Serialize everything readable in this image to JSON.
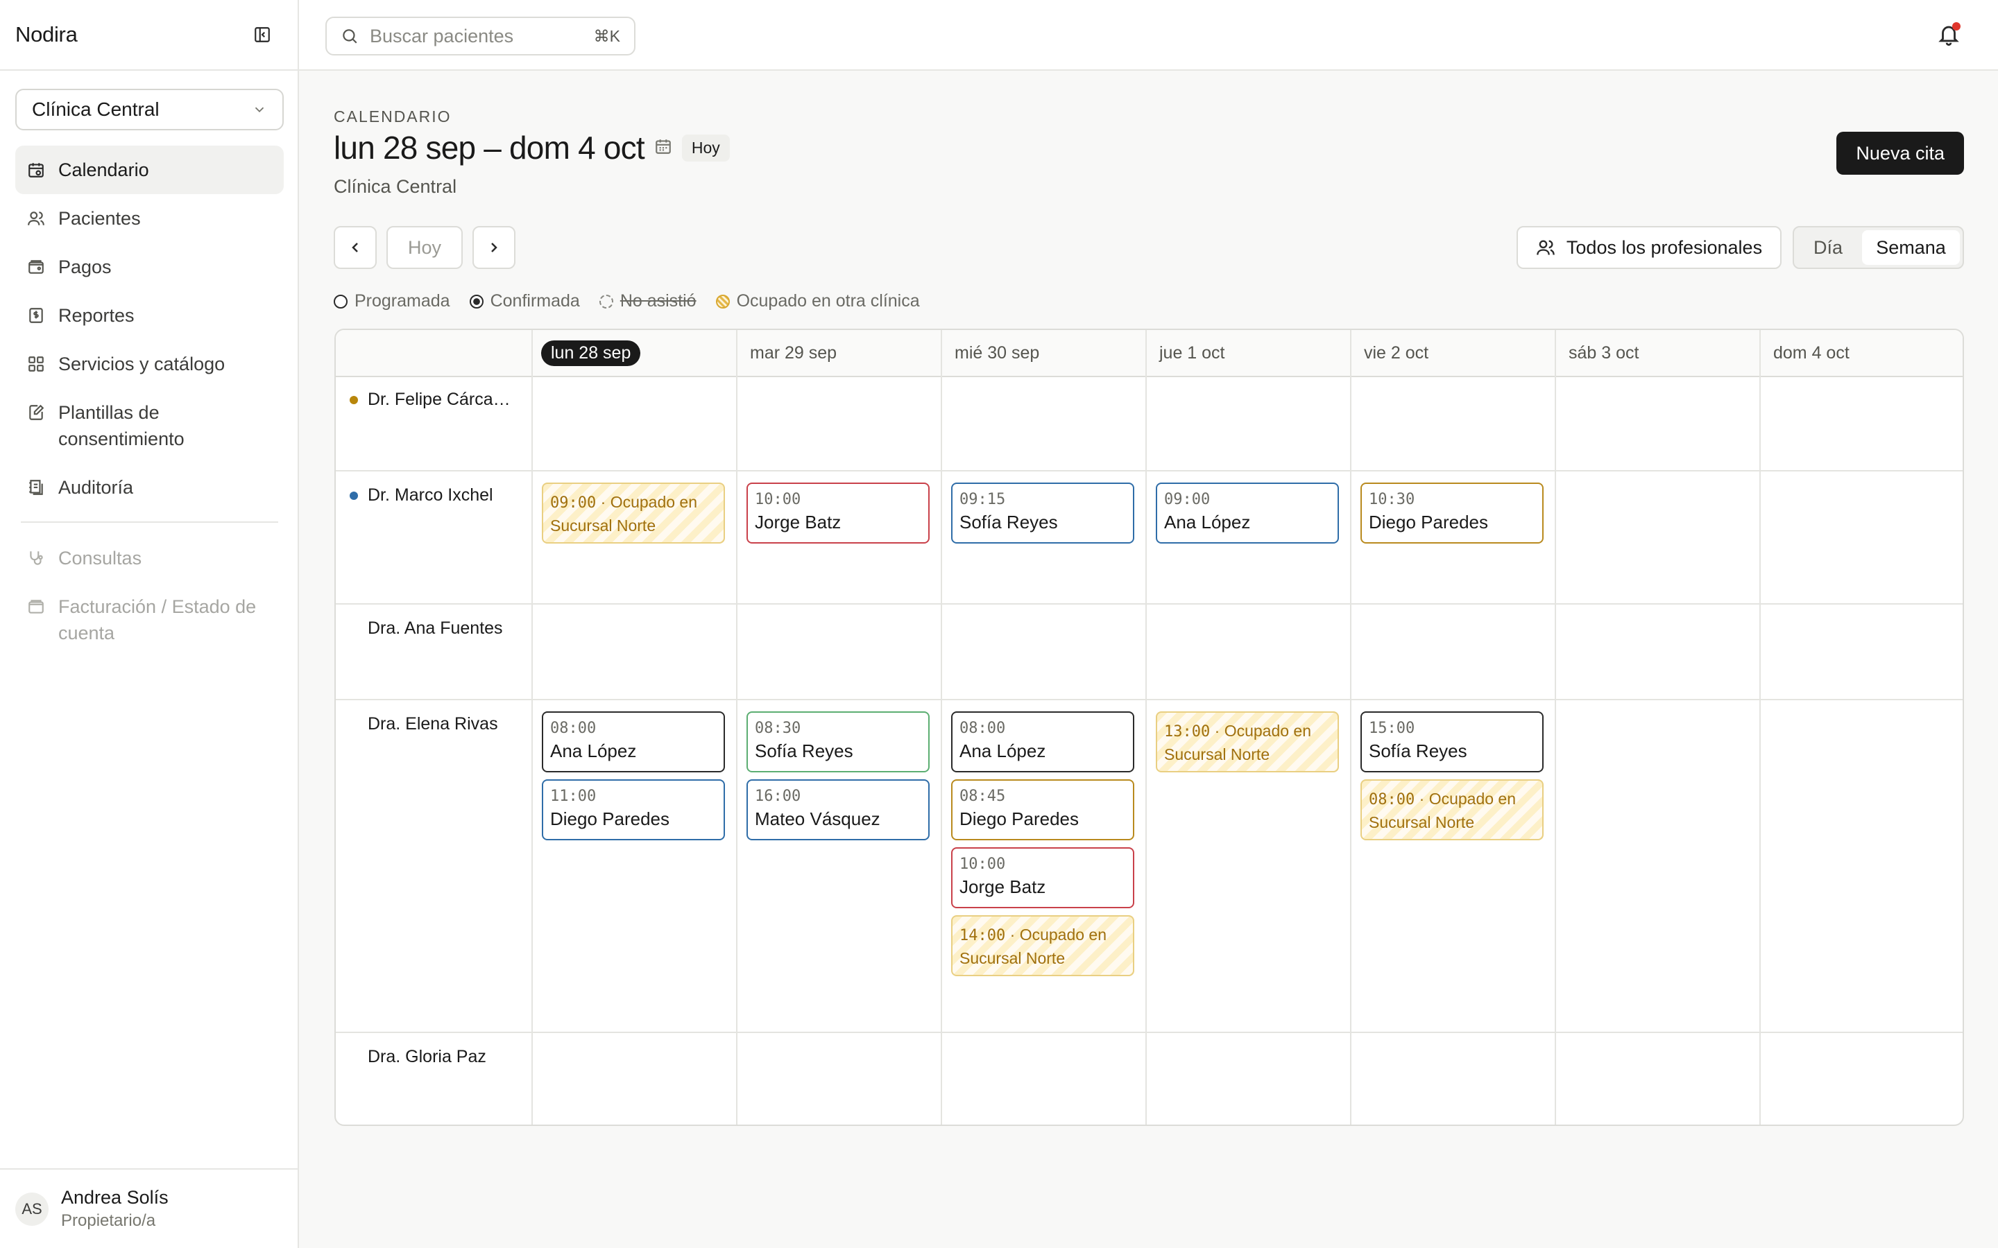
{
  "app": {
    "brand": "Nodira",
    "clinic_selected": "Clínica Central"
  },
  "sidebar": {
    "items": [
      {
        "label": "Calendario",
        "icon": "calendar-icon",
        "active": true
      },
      {
        "label": "Pacientes",
        "icon": "users-icon"
      },
      {
        "label": "Pagos",
        "icon": "wallet-icon"
      },
      {
        "label": "Reportes",
        "icon": "receipt-icon"
      },
      {
        "label": "Servicios y catálogo",
        "icon": "grid-icon"
      },
      {
        "label": "Plantillas de consentimiento",
        "icon": "document-edit-icon"
      },
      {
        "label": "Auditoría",
        "icon": "audit-icon"
      }
    ],
    "disabled_items": [
      {
        "label": "Consultas",
        "icon": "stethoscope-icon"
      },
      {
        "label": "Facturación / Estado de cuenta",
        "icon": "billing-icon"
      }
    ],
    "user": {
      "initials": "AS",
      "name": "Andrea Solís",
      "role": "Propietario/a"
    }
  },
  "topbar": {
    "search_placeholder": "Buscar pacientes",
    "search_shortcut": "⌘K"
  },
  "header": {
    "eyebrow": "CALENDARIO",
    "title": "lun 28 sep – dom 4 oct",
    "today_chip": "Hoy",
    "subtitle": "Clínica Central",
    "new_button": "Nueva cita"
  },
  "controls": {
    "today_button": "Hoy",
    "professionals_filter": "Todos los profesionales",
    "view_day": "Día",
    "view_week": "Semana"
  },
  "legend": {
    "scheduled": "Programada",
    "confirmed": "Confirmada",
    "no_show": "No asistió",
    "busy_other": "Ocupado en otra clínica"
  },
  "calendar": {
    "days": [
      "lun 28 sep",
      "mar 29 sep",
      "mié 30 sep",
      "jue 1 oct",
      "vie 2 oct",
      "sáb 3 oct",
      "dom 4 oct"
    ],
    "today_index": 0,
    "professionals": [
      {
        "name": "Dr. Felipe Cárca…",
        "dot": "#b8860b"
      },
      {
        "name": "Dr. Marco Ixchel",
        "dot": "#2f6da8"
      },
      {
        "name": "Dra. Ana Fuentes",
        "dot": ""
      },
      {
        "name": "Dra. Elena Rivas",
        "dot": ""
      },
      {
        "name": "Dra. Gloria Paz",
        "dot": ""
      }
    ],
    "appointments": [
      {
        "prof": 1,
        "day": 0,
        "slot": 0,
        "time": "09:00",
        "busy": true,
        "text": "Ocupado en Sucursal Norte"
      },
      {
        "prof": 1,
        "day": 1,
        "slot": 0,
        "time": "10:00",
        "name": "Jorge Batz",
        "color": "red"
      },
      {
        "prof": 1,
        "day": 2,
        "slot": 0,
        "time": "09:15",
        "name": "Sofía Reyes",
        "color": "blue"
      },
      {
        "prof": 1,
        "day": 3,
        "slot": 0,
        "time": "09:00",
        "name": "Ana López",
        "color": "blue"
      },
      {
        "prof": 1,
        "day": 4,
        "slot": 0,
        "time": "10:30",
        "name": "Diego Paredes",
        "color": "gold"
      },
      {
        "prof": 3,
        "day": 0,
        "slot": 0,
        "time": "08:00",
        "name": "Ana López",
        "color": "dark"
      },
      {
        "prof": 3,
        "day": 0,
        "slot": 1,
        "time": "11:00",
        "name": "Diego Paredes",
        "color": "blue"
      },
      {
        "prof": 3,
        "day": 1,
        "slot": 0,
        "time": "08:30",
        "name": "Sofía Reyes",
        "color": "green"
      },
      {
        "prof": 3,
        "day": 1,
        "slot": 1,
        "time": "16:00",
        "name": "Mateo Vásquez",
        "color": "blue"
      },
      {
        "prof": 3,
        "day": 2,
        "slot": 0,
        "time": "08:00",
        "name": "Ana López",
        "color": "dark"
      },
      {
        "prof": 3,
        "day": 2,
        "slot": 1,
        "time": "08:45",
        "name": "Diego Paredes",
        "color": "gold"
      },
      {
        "prof": 3,
        "day": 2,
        "slot": 2,
        "time": "10:00",
        "name": "Jorge Batz",
        "color": "red"
      },
      {
        "prof": 3,
        "day": 2,
        "slot": 3,
        "time": "14:00",
        "busy": true,
        "text": "Ocupado en Sucursal Norte"
      },
      {
        "prof": 3,
        "day": 3,
        "slot": 0,
        "time": "13:00",
        "busy": true,
        "text": "Ocupado en Sucursal Norte"
      },
      {
        "prof": 3,
        "day": 4,
        "slot": 0,
        "time": "15:00",
        "name": "Sofía Reyes",
        "color": "dark"
      },
      {
        "prof": 3,
        "day": 4,
        "slot": 1,
        "time": "08:00",
        "busy": true,
        "text": "Ocupado en Sucursal Norte"
      }
    ]
  },
  "colors": {
    "accent": "#1a1a1a",
    "red": "#c9414a",
    "blue": "#2f6da8",
    "gold": "#b98a1e",
    "green": "#5cae72",
    "busy": "#e9cf82",
    "notification": "#e0362c"
  }
}
